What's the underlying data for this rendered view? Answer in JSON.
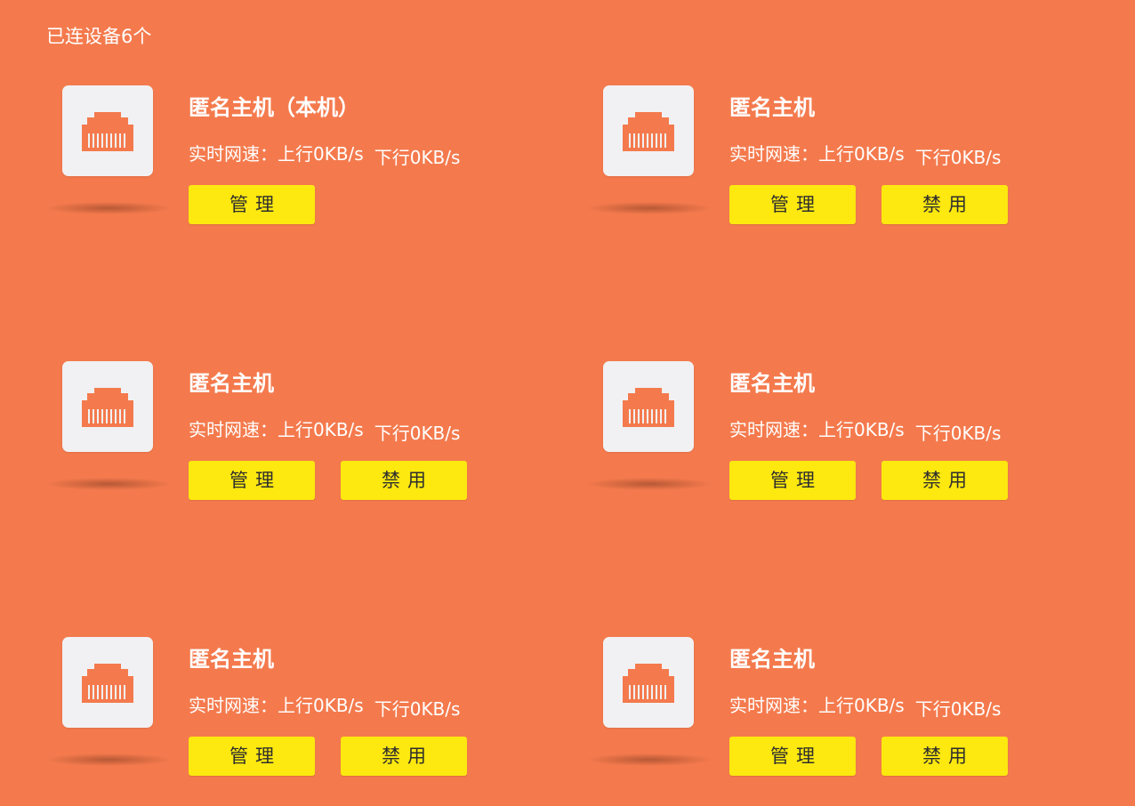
{
  "header": {
    "connected_count_label": "已连设备6个"
  },
  "icons": {
    "device_icon": "ethernet-port-icon",
    "icon_color": "#f47a4d"
  },
  "colors": {
    "background": "#f47a4d",
    "button": "#fde80f",
    "icon_box": "#f1f1f3"
  },
  "devices": [
    {
      "name": "匿名主机（本机）",
      "speed_label": "实时网速：",
      "upload": "上行0KB/s",
      "download": "下行0KB/s",
      "manage_label": "管理",
      "disable_label": ""
    },
    {
      "name": "匿名主机",
      "speed_label": "实时网速：",
      "upload": "上行0KB/s",
      "download": "下行0KB/s",
      "manage_label": "管理",
      "disable_label": "禁用"
    },
    {
      "name": "匿名主机",
      "speed_label": "实时网速：",
      "upload": "上行0KB/s",
      "download": "下行0KB/s",
      "manage_label": "管理",
      "disable_label": "禁用"
    },
    {
      "name": "匿名主机",
      "speed_label": "实时网速：",
      "upload": "上行0KB/s",
      "download": "下行0KB/s",
      "manage_label": "管理",
      "disable_label": "禁用"
    },
    {
      "name": "匿名主机",
      "speed_label": "实时网速：",
      "upload": "上行0KB/s",
      "download": "下行0KB/s",
      "manage_label": "管理",
      "disable_label": "禁用"
    },
    {
      "name": "匿名主机",
      "speed_label": "实时网速：",
      "upload": "上行0KB/s",
      "download": "下行0KB/s",
      "manage_label": "管理",
      "disable_label": "禁用"
    }
  ]
}
